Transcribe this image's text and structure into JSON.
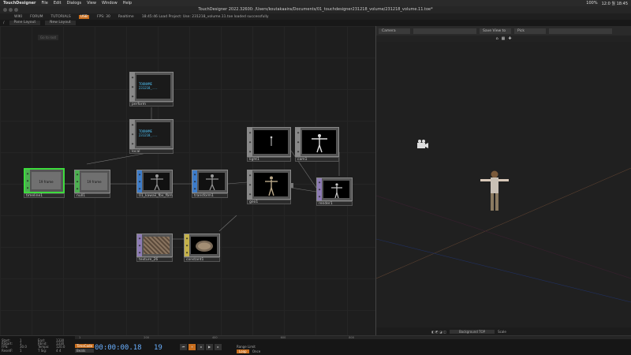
{
  "mac_menu": {
    "app": "TouchDesigner",
    "items": [
      "File",
      "Edit",
      "Dialogs",
      "View",
      "Window",
      "Help"
    ],
    "clock": "12:0 월 18:45",
    "battery": "100%"
  },
  "window_title": "TouchDesigner 2022.32600: /Users/koutakaaira/Documents/01_touchdesigner231218_volume/231218_volume.11.toe*",
  "menu": {
    "items": [
      "WIKI",
      "FORUM",
      "TUTORIALS",
      "USB",
      "FPS: 30"
    ],
    "realtime": "Realtime",
    "status": "18:45:46 Load Project: Use: 231218_volume.11.toe loaded successfully"
  },
  "tabs": {
    "path": "/",
    "pane": "Pane Layout",
    "new_layout": "New Layout"
  },
  "network_hint": "Go to root",
  "operators": {
    "perform": {
      "label": "perform",
      "text": "TOONAME 231218_..."
    },
    "local": {
      "label": "local",
      "text": "TOONAME 231218_..."
    },
    "timeline1": {
      "label": "timeline1",
      "text": "19 frame"
    },
    "null1": {
      "label": "null1",
      "text": "19 frame"
    },
    "kawaii": {
      "label": "01_kawaii_fbx_fbm"
    },
    "transform1": {
      "label": "transform1"
    },
    "light1": {
      "label": "light1"
    },
    "cam1": {
      "label": "cam1"
    },
    "geo1": {
      "label": "geo1"
    },
    "render1": {
      "label": "render1"
    },
    "texture": {
      "label": "texture_26"
    },
    "constant1": {
      "label": "constant1"
    }
  },
  "viewer": {
    "camera_select": "Camera",
    "save_view": "Save View to",
    "pick": "Pick",
    "bottom_label": "Background TOP",
    "scale_label": "Scale"
  },
  "timeline": {
    "ruler": [
      "1",
      "200",
      "400",
      "600",
      "800"
    ],
    "stats": [
      "Start:",
      "1",
      "End:",
      "1330",
      "RStart:",
      "1",
      "REnd:",
      "1330",
      "FPS:",
      "30.0",
      "Tempo:",
      "120.0",
      "ResetF:",
      "1",
      "T Sig:",
      "4 4"
    ],
    "time_code_btn": "TimeCode",
    "beats_btn": "Beats",
    "timecode": "00:00:00.18",
    "frame": "19",
    "range_label": "Range Limit",
    "range_loop": "Loop",
    "range_once": "Once"
  },
  "colors": {
    "accent": "#c86e1e",
    "selected": "#3ddc3d",
    "timecode": "#6ab0ff"
  }
}
